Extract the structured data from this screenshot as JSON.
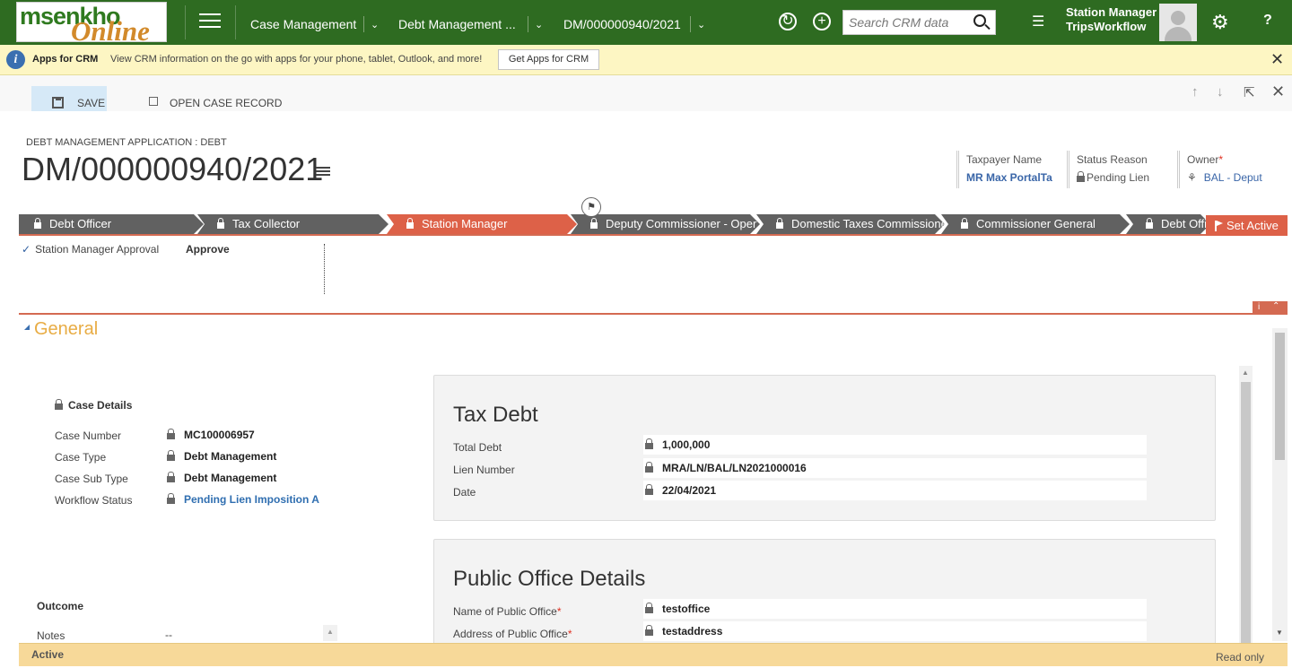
{
  "logo": {
    "line1": "msenkho",
    "line2": "Online"
  },
  "nav": {
    "items": [
      "Case Management",
      "Debt Management ...",
      "DM/000000940/2021"
    ]
  },
  "search": {
    "placeholder": "Search CRM data"
  },
  "user": {
    "role": "Station Manager",
    "name": "TripsWorkflow"
  },
  "notification": {
    "title": "Apps for CRM",
    "message": "View CRM information on the go with apps for your phone, tablet, Outlook, and more!",
    "button": "Get Apps for CRM"
  },
  "commands": {
    "save": "SAVE",
    "open_case": "OPEN CASE RECORD"
  },
  "header": {
    "entity": "DEBT MANAGEMENT APPLICATION : DEBT",
    "record": "DM/000000940/2021",
    "fields": [
      {
        "label": "Taxpayer Name",
        "value": "MR Max PortalTa"
      },
      {
        "label": "Status Reason",
        "value": "Pending Lien"
      },
      {
        "label": "Owner",
        "value": "BAL - Deput"
      }
    ]
  },
  "process": {
    "stages": [
      "Debt Officer",
      "Tax Collector",
      "Station Manager",
      "Deputy Commissioner - Oper",
      "Domestic Taxes Commissione",
      "Commissioner General",
      "Debt Offi"
    ],
    "active_stage": "Station Manager",
    "set_active": "Set Active",
    "step_label": "Station Manager Approval",
    "step_value": "Approve"
  },
  "section": {
    "title": "General"
  },
  "case_details": {
    "title": "Case Details",
    "rows": [
      {
        "label": "Case Number",
        "value": "MC100006957"
      },
      {
        "label": "Case Type",
        "value": "Debt Management"
      },
      {
        "label": "Case Sub Type",
        "value": "Debt Management"
      },
      {
        "label": "Workflow Status",
        "value": "Pending Lien Imposition A"
      }
    ]
  },
  "outcome": {
    "title": "Outcome",
    "notes_label": "Notes",
    "notes_value": "--"
  },
  "tax_debt": {
    "title": "Tax Debt",
    "rows": [
      {
        "label": "Total Debt",
        "value": "1,000,000"
      },
      {
        "label": "Lien Number",
        "value": "MRA/LN/BAL/LN2021000016"
      },
      {
        "label": "Date",
        "value": "22/04/2021"
      }
    ]
  },
  "public_office": {
    "title": "Public Office Details",
    "rows": [
      {
        "label": "Name of Public Office",
        "value": "testoffice"
      },
      {
        "label": "Address of Public Office",
        "value": "testaddress"
      }
    ]
  },
  "footer": {
    "status": "Active",
    "mode": "Read only"
  }
}
